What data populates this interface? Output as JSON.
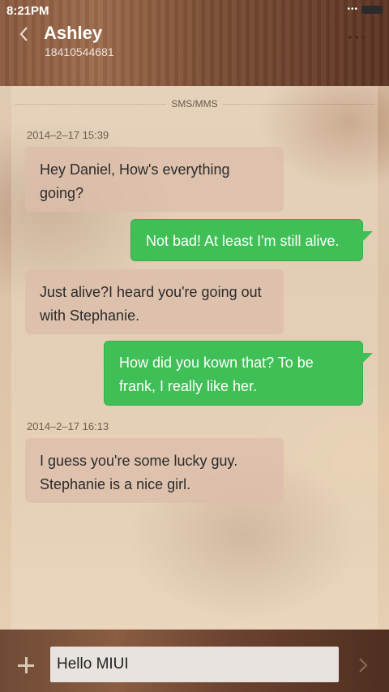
{
  "status_bar": {
    "time": "8:21PM"
  },
  "header": {
    "contact_name": "Ashley",
    "contact_number": "18410544681"
  },
  "conversation": {
    "channel_label": "SMS/MMS",
    "timestamps": [
      "2014–2–17 15:39",
      "2014–2–17 16:13"
    ],
    "messages": [
      {
        "direction": "incoming",
        "text": "Hey Daniel, How's everything going?"
      },
      {
        "direction": "outgoing",
        "text": "Not bad! At least I'm still alive."
      },
      {
        "direction": "incoming",
        "text": "Just  alive?I heard you're going out with Stephanie."
      },
      {
        "direction": "outgoing",
        "text": "How did you kown that? To be frank, I really like her."
      },
      {
        "direction": "incoming",
        "text": "I guess you're some lucky guy. Stephanie is a nice girl."
      }
    ]
  },
  "composer": {
    "input_value": "Hello MIUI"
  },
  "colors": {
    "outgoing_bubble": "#3fbf55",
    "incoming_bubble": "#dcbeaa"
  }
}
